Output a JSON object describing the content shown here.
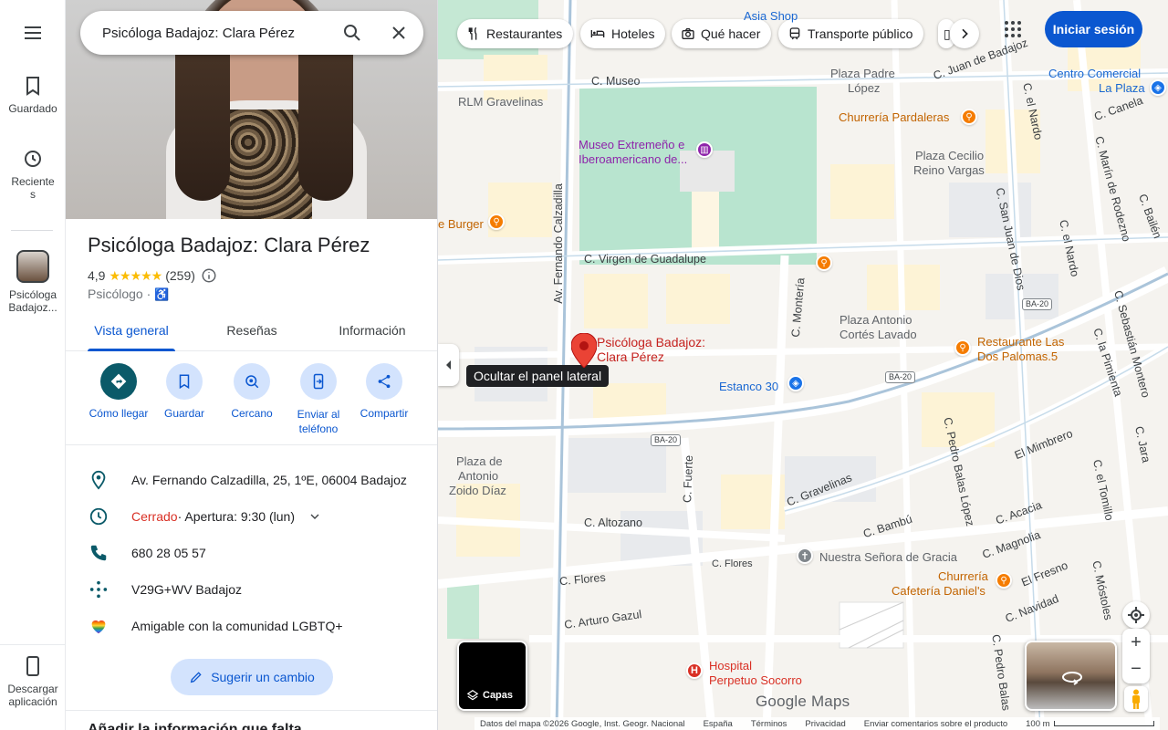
{
  "rail": {
    "saved": "Guardado",
    "recent_line1": "Reciente",
    "recent_line2": "s",
    "place_line1": "Psicóloga",
    "place_line2": "Badajoz...",
    "download_line1": "Descargar",
    "download_line2": "aplicación"
  },
  "search": {
    "value": "Psicóloga Badajoz: Clara Pérez"
  },
  "place": {
    "title": "Psicóloga Badajoz: Clara Pérez",
    "rating": "4,9",
    "stars": "★★★★★",
    "reviews": "(259)",
    "category": "Psicólogo ·"
  },
  "tabs": [
    "Vista general",
    "Reseñas",
    "Información"
  ],
  "actions": [
    "Cómo llegar",
    "Guardar",
    "Cercano",
    "Enviar al teléfono",
    "Compartir"
  ],
  "info": {
    "address": "Av. Fernando Calzadilla, 25, 1ºE, 06004 Badajoz",
    "status": "Cerrado",
    "hours": " · Apertura: 9:30 (lun)",
    "phone": "680 28 05 57",
    "pluscode": "V29G+WV Badajoz",
    "lgbtq": "Amigable con la comunidad LGBTQ+"
  },
  "suggest": "Sugerir un cambio",
  "more_section": "Añadir la información que falta",
  "chips": [
    "Restaurantes",
    "Hoteles",
    "Qué hacer",
    "Transporte público"
  ],
  "signin": "Iniciar sesión",
  "tooltip": "Ocultar el panel lateral",
  "map": {
    "pin_label_1": "Psicóloga Badajoz:",
    "pin_label_2": "Clara Pérez",
    "layers": "Capas",
    "brand": "Google Maps",
    "labels": {
      "asia_shop": "Asia Shop",
      "c_museo": "C. Museo",
      "rlm": "RLM Gravelinas",
      "museo1": "Museo Extremeño e",
      "museo2": "Iberoamericano de...",
      "plaza_padre1": "Plaza Padre",
      "plaza_padre2": "López",
      "juan_badajoz": "C. Juan de Badajoz",
      "churreria_p": "Churrería Pardaleras",
      "centro1": "Centro Comercial",
      "centro2": "La Plaza",
      "canela": "C. Canela",
      "plaza_cecilio1": "Plaza Cecilio",
      "plaza_cecilio2": "Reino Vargas",
      "burger": "e Burger",
      "fernando": "Av. Fernando Calzadilla",
      "virgen": "C. Virgen de Guadalupe",
      "montera": "C. Montería",
      "san_juan": "C. San Juan de Dios",
      "nardo": "C. el Nardo",
      "nardo2": "C. el Nardo",
      "marin": "C. Marín de Rodezno",
      "bailen": "C. Bailén",
      "plaza_antonio1": "Plaza Antonio",
      "plaza_antonio2": "Cortés Lavado",
      "rest_palomas1": "Restaurante Las",
      "rest_palomas2": "Dos Palomas.5",
      "estanco": "Estanco 30",
      "sebastian": "C. Sebastián Montero",
      "pimienta": "C. la Pimienta",
      "plaza_zoido1": "Plaza de",
      "plaza_zoido2": "Antonio",
      "plaza_zoido3": "Zoido Díaz",
      "fuerte": "C. Fuerte",
      "gravelinas": "C. Gravelinas",
      "pedro_balas": "C. Pedro Balas López",
      "mimbrero": "El Mimbrero",
      "tomillo": "C. el Tomillo",
      "jara": "C. Jara",
      "altozano": "C. Altozano",
      "bambu": "C. Bambú",
      "acacia": "C. Acacia",
      "nuestra": "Nuestra Señora de Gracia",
      "magnolia": "C. Magnolia",
      "flores": "C. Flores",
      "flores2": "C. Flores",
      "fresno": "El Fresno",
      "churreria_d1": "Churrería",
      "churreria_d2": "Cafetería Daniel's",
      "arturo": "C. Arturo Gazul",
      "navidad": "C. Navidad",
      "mostoles": "C. Móstoles",
      "hospital1": "Hospital",
      "hospital2": "Perpetuo Socorro",
      "pedro_balas2": "C. Pedro Balas",
      "ba20a": "BA-20",
      "ba20b": "BA-20",
      "ba20c": "BA-20"
    },
    "footer": [
      "Datos del mapa ©2026 Google, Inst. Geogr. Nacional",
      "España",
      "Términos",
      "Privacidad",
      "Enviar comentarios sobre el producto",
      "100 m"
    ]
  }
}
